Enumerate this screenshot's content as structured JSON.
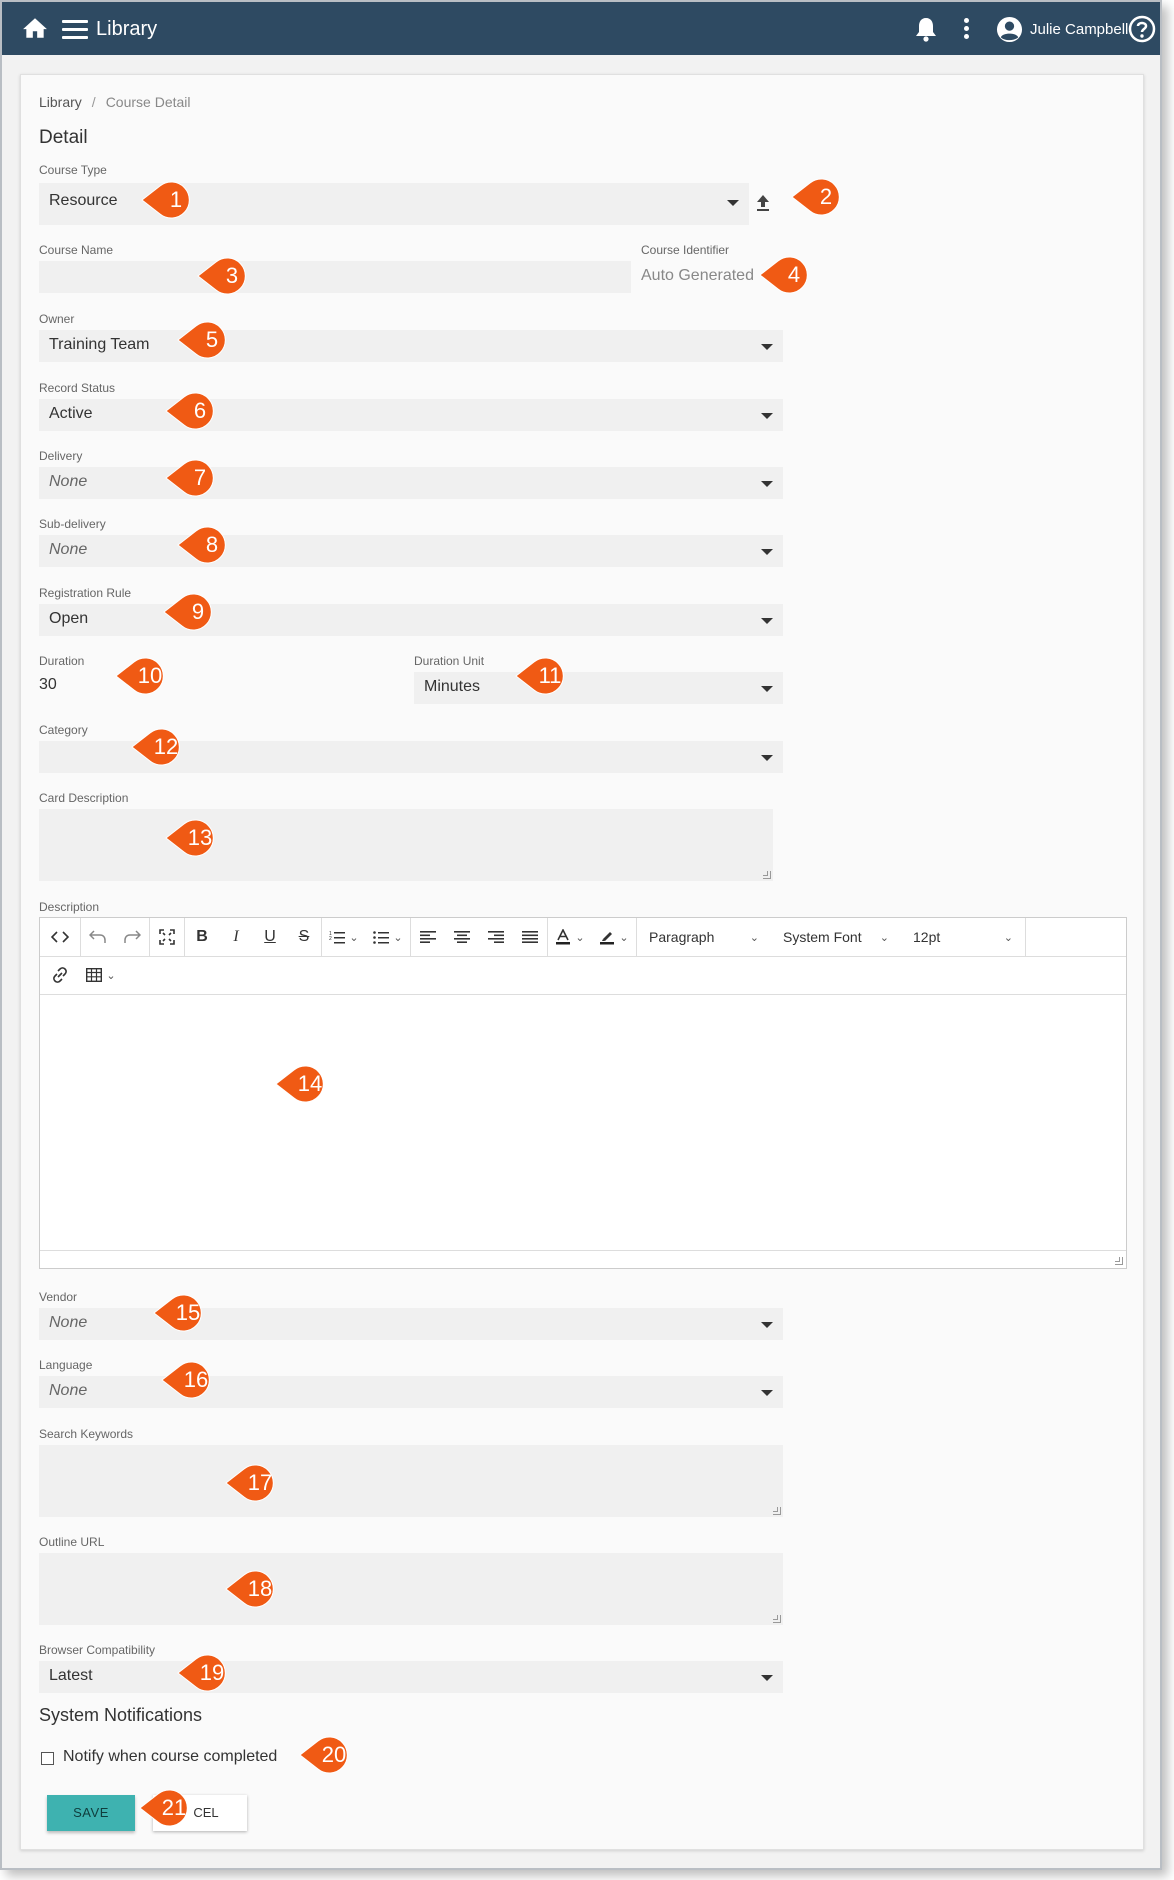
{
  "header": {
    "title": "Library",
    "user_name": "Julie Campbell",
    "bg_color": "#2e4a62"
  },
  "breadcrumb": {
    "root": "Library",
    "separator": "/",
    "current": "Course Detail"
  },
  "section_title": "Detail",
  "fields": {
    "course_type": {
      "label": "Course Type",
      "value": "Resource"
    },
    "course_name": {
      "label": "Course Name",
      "value": ""
    },
    "course_identifier": {
      "label": "Course Identifier",
      "value": "Auto Generated"
    },
    "owner": {
      "label": "Owner",
      "value": "Training Team"
    },
    "record_status": {
      "label": "Record Status",
      "value": "Active"
    },
    "delivery": {
      "label": "Delivery",
      "value": "None"
    },
    "sub_delivery": {
      "label": "Sub-delivery",
      "value": "None"
    },
    "registration_rule": {
      "label": "Registration Rule",
      "value": "Open"
    },
    "duration": {
      "label": "Duration",
      "value": "30"
    },
    "duration_unit": {
      "label": "Duration Unit",
      "value": "Minutes"
    },
    "category": {
      "label": "Category",
      "value": ""
    },
    "card_description": {
      "label": "Card Description",
      "value": ""
    },
    "description": {
      "label": "Description"
    },
    "vendor": {
      "label": "Vendor",
      "value": "None"
    },
    "language": {
      "label": "Language",
      "value": "None"
    },
    "search_keywords": {
      "label": "Search Keywords",
      "value": ""
    },
    "outline_url": {
      "label": "Outline URL",
      "value": ""
    },
    "browser_compatibility": {
      "label": "Browser Compatibility",
      "value": "Latest"
    }
  },
  "editor": {
    "block_format": "Paragraph",
    "font_family": "System Font",
    "font_size": "12pt",
    "toolbar_icons": [
      "code-icon",
      "undo-icon",
      "redo-icon",
      "fullscreen-icon",
      "bold-icon",
      "italic-icon",
      "underline-icon",
      "strikethrough-icon",
      "numbered-list-icon",
      "bullet-list-icon",
      "align-left-icon",
      "align-center-icon",
      "align-right-icon",
      "justify-icon",
      "text-color-icon",
      "highlight-icon",
      "link-icon",
      "table-icon"
    ]
  },
  "notifications": {
    "title": "System Notifications",
    "notify_completed_label": "Notify when course completed",
    "notify_completed_checked": false
  },
  "actions": {
    "save_label": "SAVE",
    "cancel_label": "CEL"
  },
  "callouts": [
    "1",
    "2",
    "3",
    "4",
    "5",
    "6",
    "7",
    "8",
    "9",
    "10",
    "11",
    "12",
    "13",
    "14",
    "15",
    "16",
    "17",
    "18",
    "19",
    "20",
    "21"
  ],
  "colors": {
    "callout": "#f05a14",
    "accent_button": "#3eb2b0",
    "field_bg": "#f0f0f0"
  }
}
